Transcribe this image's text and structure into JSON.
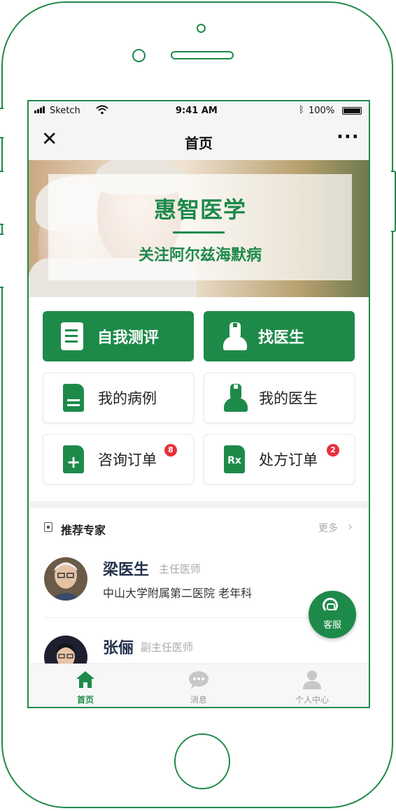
{
  "status": {
    "carrier": "Sketch",
    "time": "9:41 AM",
    "battery": "100%"
  },
  "nav": {
    "title": "首页"
  },
  "banner": {
    "brand": "惠智医学",
    "slogan": "关注阿尔兹海默病"
  },
  "actions": {
    "self_assess": "自我测评",
    "find_doctor": "找医生",
    "my_cases": "我的病例",
    "my_doctors": "我的医生",
    "consult_orders": {
      "label": "咨询订单",
      "badge": "8"
    },
    "rx_orders": {
      "label": "处方订单",
      "badge": "2"
    }
  },
  "experts": {
    "heading": "推荐专家",
    "more": "更多",
    "items": [
      {
        "name": "梁医生",
        "title": "主任医师",
        "hospital": "中山大学附属第二医院  老年科"
      },
      {
        "name": "张俪",
        "title": "副主任医师",
        "hospital": ""
      }
    ]
  },
  "fab": {
    "label": "客服"
  },
  "tabs": [
    {
      "label": "首页",
      "icon": "home-icon",
      "active": true
    },
    {
      "label": "消息",
      "icon": "message-icon",
      "active": false
    },
    {
      "label": "个人中心",
      "icon": "user-icon",
      "active": false
    }
  ],
  "colors": {
    "brand": "#1e8a4a",
    "badge": "#e8313c"
  }
}
